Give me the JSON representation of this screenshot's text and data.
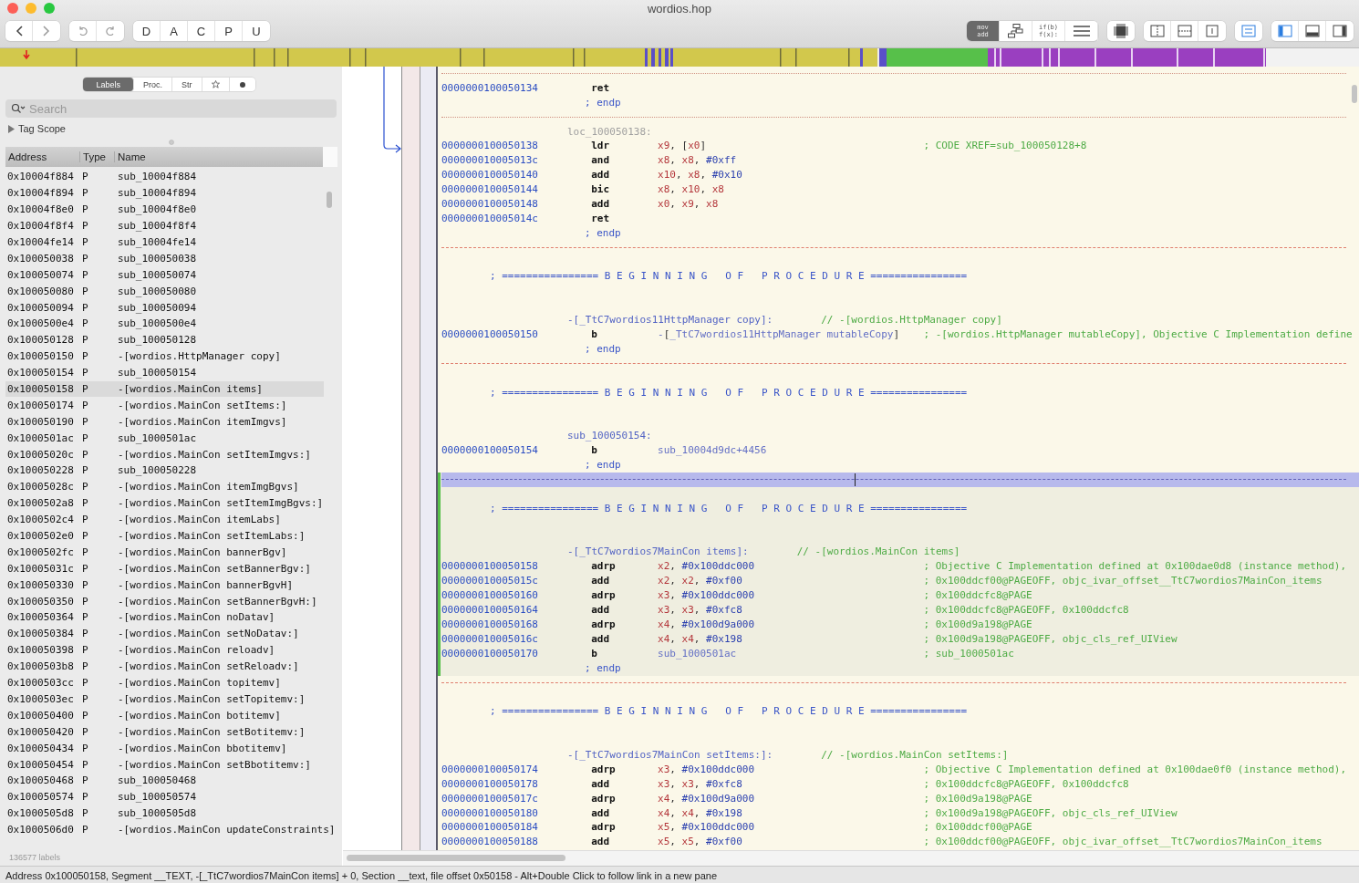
{
  "window": {
    "title": "wordios.hop"
  },
  "toolbar": {
    "edit_buttons": [
      "D",
      "A",
      "C",
      "P",
      "U"
    ],
    "view_modes": [
      {
        "kind": "text",
        "lines": [
          "mov",
          "add"
        ],
        "selected": true
      },
      {
        "kind": "graph",
        "selected": false
      },
      {
        "kind": "text",
        "lines": [
          "if(b)",
          "f(x):"
        ],
        "selected": false
      },
      {
        "kind": "hex",
        "selected": false
      }
    ],
    "link_toggle": {
      "on": true
    },
    "panels": [
      {
        "kind": "left",
        "on": true
      },
      {
        "kind": "bottom",
        "on": false
      },
      {
        "kind": "right",
        "on": false
      }
    ]
  },
  "sidebar": {
    "tabs": [
      {
        "kind": "text",
        "label": "Labels",
        "selected": true
      },
      {
        "kind": "text",
        "label": "Proc.",
        "selected": false
      },
      {
        "kind": "text",
        "label": "Str",
        "selected": false
      },
      {
        "kind": "star",
        "selected": false
      },
      {
        "kind": "dot",
        "selected": false
      }
    ],
    "search": {
      "placeholder": "Search"
    },
    "tag_scope": {
      "label": "Tag Scope",
      "expanded": false
    },
    "columns": [
      "Address",
      "Type",
      "Name"
    ],
    "rows": [
      {
        "address": "0x10004f884",
        "type": "P",
        "name": "sub_10004f884",
        "selected": false
      },
      {
        "address": "0x10004f894",
        "type": "P",
        "name": "sub_10004f894",
        "selected": false
      },
      {
        "address": "0x10004f8e0",
        "type": "P",
        "name": "sub_10004f8e0",
        "selected": false
      },
      {
        "address": "0x10004f8f4",
        "type": "P",
        "name": "sub_10004f8f4",
        "selected": false
      },
      {
        "address": "0x10004fe14",
        "type": "P",
        "name": "sub_10004fe14",
        "selected": false
      },
      {
        "address": "0x100050038",
        "type": "P",
        "name": "sub_100050038",
        "selected": false
      },
      {
        "address": "0x100050074",
        "type": "P",
        "name": "sub_100050074",
        "selected": false
      },
      {
        "address": "0x100050080",
        "type": "P",
        "name": "sub_100050080",
        "selected": false
      },
      {
        "address": "0x100050094",
        "type": "P",
        "name": "sub_100050094",
        "selected": false
      },
      {
        "address": "0x1000500e4",
        "type": "P",
        "name": "sub_1000500e4",
        "selected": false
      },
      {
        "address": "0x100050128",
        "type": "P",
        "name": "sub_100050128",
        "selected": false
      },
      {
        "address": "0x100050150",
        "type": "P",
        "name": "-[wordios.HttpManager copy]",
        "selected": false
      },
      {
        "address": "0x100050154",
        "type": "P",
        "name": "sub_100050154",
        "selected": false
      },
      {
        "address": "0x100050158",
        "type": "P",
        "name": "-[wordios.MainCon items]",
        "selected": true
      },
      {
        "address": "0x100050174",
        "type": "P",
        "name": "-[wordios.MainCon setItems:]",
        "selected": false
      },
      {
        "address": "0x100050190",
        "type": "P",
        "name": "-[wordios.MainCon itemImgvs]",
        "selected": false
      },
      {
        "address": "0x1000501ac",
        "type": "P",
        "name": "sub_1000501ac",
        "selected": false
      },
      {
        "address": "0x10005020c",
        "type": "P",
        "name": "-[wordios.MainCon setItemImgvs:]",
        "selected": false
      },
      {
        "address": "0x100050228",
        "type": "P",
        "name": "sub_100050228",
        "selected": false
      },
      {
        "address": "0x10005028c",
        "type": "P",
        "name": "-[wordios.MainCon itemImgBgvs]",
        "selected": false
      },
      {
        "address": "0x1000502a8",
        "type": "P",
        "name": "-[wordios.MainCon setItemImgBgvs:]",
        "selected": false
      },
      {
        "address": "0x1000502c4",
        "type": "P",
        "name": "-[wordios.MainCon itemLabs]",
        "selected": false
      },
      {
        "address": "0x1000502e0",
        "type": "P",
        "name": "-[wordios.MainCon setItemLabs:]",
        "selected": false
      },
      {
        "address": "0x1000502fc",
        "type": "P",
        "name": "-[wordios.MainCon bannerBgv]",
        "selected": false
      },
      {
        "address": "0x10005031c",
        "type": "P",
        "name": "-[wordios.MainCon setBannerBgv:]",
        "selected": false
      },
      {
        "address": "0x100050330",
        "type": "P",
        "name": "-[wordios.MainCon bannerBgvH]",
        "selected": false
      },
      {
        "address": "0x100050350",
        "type": "P",
        "name": "-[wordios.MainCon setBannerBgvH:]",
        "selected": false
      },
      {
        "address": "0x100050364",
        "type": "P",
        "name": "-[wordios.MainCon noDatav]",
        "selected": false
      },
      {
        "address": "0x100050384",
        "type": "P",
        "name": "-[wordios.MainCon setNoDatav:]",
        "selected": false
      },
      {
        "address": "0x100050398",
        "type": "P",
        "name": "-[wordios.MainCon reloadv]",
        "selected": false
      },
      {
        "address": "0x1000503b8",
        "type": "P",
        "name": "-[wordios.MainCon setReloadv:]",
        "selected": false
      },
      {
        "address": "0x1000503cc",
        "type": "P",
        "name": "-[wordios.MainCon topitemv]",
        "selected": false
      },
      {
        "address": "0x1000503ec",
        "type": "P",
        "name": "-[wordios.MainCon setTopitemv:]",
        "selected": false
      },
      {
        "address": "0x100050400",
        "type": "P",
        "name": "-[wordios.MainCon botitemv]",
        "selected": false
      },
      {
        "address": "0x100050420",
        "type": "P",
        "name": "-[wordios.MainCon setBotitemv:]",
        "selected": false
      },
      {
        "address": "0x100050434",
        "type": "P",
        "name": "-[wordios.MainCon bbotitemv]",
        "selected": false
      },
      {
        "address": "0x100050454",
        "type": "P",
        "name": "-[wordios.MainCon setBbotitemv:]",
        "selected": false
      },
      {
        "address": "0x100050468",
        "type": "P",
        "name": "sub_100050468",
        "selected": false
      },
      {
        "address": "0x100050574",
        "type": "P",
        "name": "sub_100050574",
        "selected": false
      },
      {
        "address": "0x1000505d8",
        "type": "P",
        "name": "sub_1000505d8",
        "selected": false
      },
      {
        "address": "0x1000506d0",
        "type": "P",
        "name": "-[wordios.MainCon updateConstraints]",
        "selected": false
      }
    ],
    "footer": "136577 labels"
  },
  "listing": {
    "blocks": [
      {
        "current": false,
        "lines": [
          {
            "kind": "dotted_rule",
            "selected": false
          },
          {
            "kind": "instr",
            "address": "0000000100050134",
            "mnemonic": "ret",
            "selected": false
          },
          {
            "kind": "endp",
            "text": "; endp",
            "selected": false
          },
          {
            "kind": "dotted_rule",
            "selected": false
          },
          {
            "kind": "local_label",
            "text": "loc_100050138:",
            "selected": false
          },
          {
            "kind": "instr",
            "address": "0000000100050138",
            "mnemonic": "ldr",
            "operands": "x9, [x0]",
            "comment": "; CODE XREF=sub_100050128+8",
            "selected": false
          },
          {
            "kind": "instr",
            "address": "000000010005013c",
            "mnemonic": "and",
            "operands": "x8, x8, #0xff",
            "selected": false
          },
          {
            "kind": "instr",
            "address": "0000000100050140",
            "mnemonic": "add",
            "operands": "x10, x8, #0x10",
            "selected": false
          },
          {
            "kind": "instr",
            "address": "0000000100050144",
            "mnemonic": "bic",
            "operands": "x8, x10, x8",
            "selected": false
          },
          {
            "kind": "instr",
            "address": "0000000100050148",
            "mnemonic": "add",
            "operands": "x0, x9, x8",
            "selected": false
          },
          {
            "kind": "instr",
            "address": "000000010005014c",
            "mnemonic": "ret",
            "selected": false
          },
          {
            "kind": "endp",
            "text": "; endp",
            "selected": false
          },
          {
            "kind": "dashed_rule",
            "selected": false
          },
          {
            "kind": "banner",
            "text": "; ================ B E G I N N I N G   O F   P R O C E D U R E ================",
            "selected": false
          },
          {
            "kind": "proc_label",
            "text": "-[_TtC7wordios11HttpManager copy]:",
            "comment": "// -[wordios.HttpManager copy]",
            "selected": false
          },
          {
            "kind": "instr",
            "address": "0000000100050150",
            "mnemonic": "b",
            "operands": "-[_TtC7wordios11HttpManager mutableCopy]",
            "comment": "; -[wordios.HttpManager mutableCopy], Objective C Implementation define",
            "selected": false
          },
          {
            "kind": "endp",
            "text": "; endp",
            "selected": false
          },
          {
            "kind": "dashed_rule",
            "selected": false
          },
          {
            "kind": "banner",
            "text": "; ================ B E G I N N I N G   O F   P R O C E D U R E ================",
            "selected": false
          },
          {
            "kind": "proc_label",
            "text": "sub_100050154:",
            "selected": false
          },
          {
            "kind": "instr",
            "address": "0000000100050154",
            "mnemonic": "b",
            "operands": "sub_10004d9dc+4456",
            "selected": false
          },
          {
            "kind": "endp",
            "text": "; endp",
            "selected": false
          }
        ]
      },
      {
        "current": true,
        "lines": [
          {
            "kind": "dashed_rule",
            "selected": true
          },
          {
            "kind": "banner",
            "text": "; ================ B E G I N N I N G   O F   P R O C E D U R E ================",
            "selected": false
          },
          {
            "kind": "proc_label",
            "text": "-[_TtC7wordios7MainCon items]:",
            "comment": "// -[wordios.MainCon items]",
            "selected": false
          },
          {
            "kind": "instr",
            "address": "0000000100050158",
            "mnemonic": "adrp",
            "operands": "x2, #0x100ddc000",
            "comment": "; Objective C Implementation defined at 0x100dae0d8 (instance method),",
            "selected": false
          },
          {
            "kind": "instr",
            "address": "000000010005015c",
            "mnemonic": "add",
            "operands": "x2, x2, #0xf00",
            "comment": "; 0x100ddcf00@PAGEOFF, objc_ivar_offset__TtC7wordios7MainCon_items",
            "selected": false
          },
          {
            "kind": "instr",
            "address": "0000000100050160",
            "mnemonic": "adrp",
            "operands": "x3, #0x100ddc000",
            "comment": "; 0x100ddcfc8@PAGE",
            "selected": false
          },
          {
            "kind": "instr",
            "address": "0000000100050164",
            "mnemonic": "add",
            "operands": "x3, x3, #0xfc8",
            "comment": "; 0x100ddcfc8@PAGEOFF, 0x100ddcfc8",
            "selected": false
          },
          {
            "kind": "instr",
            "address": "0000000100050168",
            "mnemonic": "adrp",
            "operands": "x4, #0x100d9a000",
            "comment": "; 0x100d9a198@PAGE",
            "selected": false
          },
          {
            "kind": "instr",
            "address": "000000010005016c",
            "mnemonic": "add",
            "operands": "x4, x4, #0x198",
            "comment": "; 0x100d9a198@PAGEOFF, objc_cls_ref_UIView",
            "selected": false
          },
          {
            "kind": "instr",
            "address": "0000000100050170",
            "mnemonic": "b",
            "operands": "sub_1000501ac",
            "comment": "; sub_1000501ac",
            "selected": false
          },
          {
            "kind": "endp",
            "text": "; endp",
            "selected": false
          }
        ]
      },
      {
        "current": false,
        "lines": [
          {
            "kind": "dashed_rule",
            "selected": false
          },
          {
            "kind": "banner",
            "text": "; ================ B E G I N N I N G   O F   P R O C E D U R E ================",
            "selected": false
          },
          {
            "kind": "proc_label",
            "text": "-[_TtC7wordios7MainCon setItems:]:",
            "comment": "// -[wordios.MainCon setItems:]",
            "selected": false
          },
          {
            "kind": "instr",
            "address": "0000000100050174",
            "mnemonic": "adrp",
            "operands": "x3, #0x100ddc000",
            "comment": "; Objective C Implementation defined at 0x100dae0f0 (instance method),",
            "selected": false
          },
          {
            "kind": "instr",
            "address": "0000000100050178",
            "mnemonic": "add",
            "operands": "x3, x3, #0xfc8",
            "comment": "; 0x100ddcfc8@PAGEOFF, 0x100ddcfc8",
            "selected": false
          },
          {
            "kind": "instr",
            "address": "000000010005017c",
            "mnemonic": "adrp",
            "operands": "x4, #0x100d9a000",
            "comment": "; 0x100d9a198@PAGE",
            "selected": false
          },
          {
            "kind": "instr",
            "address": "0000000100050180",
            "mnemonic": "add",
            "operands": "x4, x4, #0x198",
            "comment": "; 0x100d9a198@PAGEOFF, objc_cls_ref_UIView",
            "selected": false
          },
          {
            "kind": "instr",
            "address": "0000000100050184",
            "mnemonic": "adrp",
            "operands": "x5, #0x100ddc000",
            "comment": "; 0x100ddcf00@PAGE",
            "selected": false
          },
          {
            "kind": "instr",
            "address": "0000000100050188",
            "mnemonic": "add",
            "operands": "x5, x5, #0xf00",
            "comment": "; 0x100ddcf00@PAGEOFF, objc_ivar_offset__TtC7wordios7MainCon_items",
            "selected": false
          }
        ]
      }
    ]
  },
  "status_bar": "Address 0x100050158, Segment __TEXT, -[_TtC7wordios7MainCon items] + 0, Section __text, file offset 0x50158 - Alt+Double Click to follow link in a new pane"
}
